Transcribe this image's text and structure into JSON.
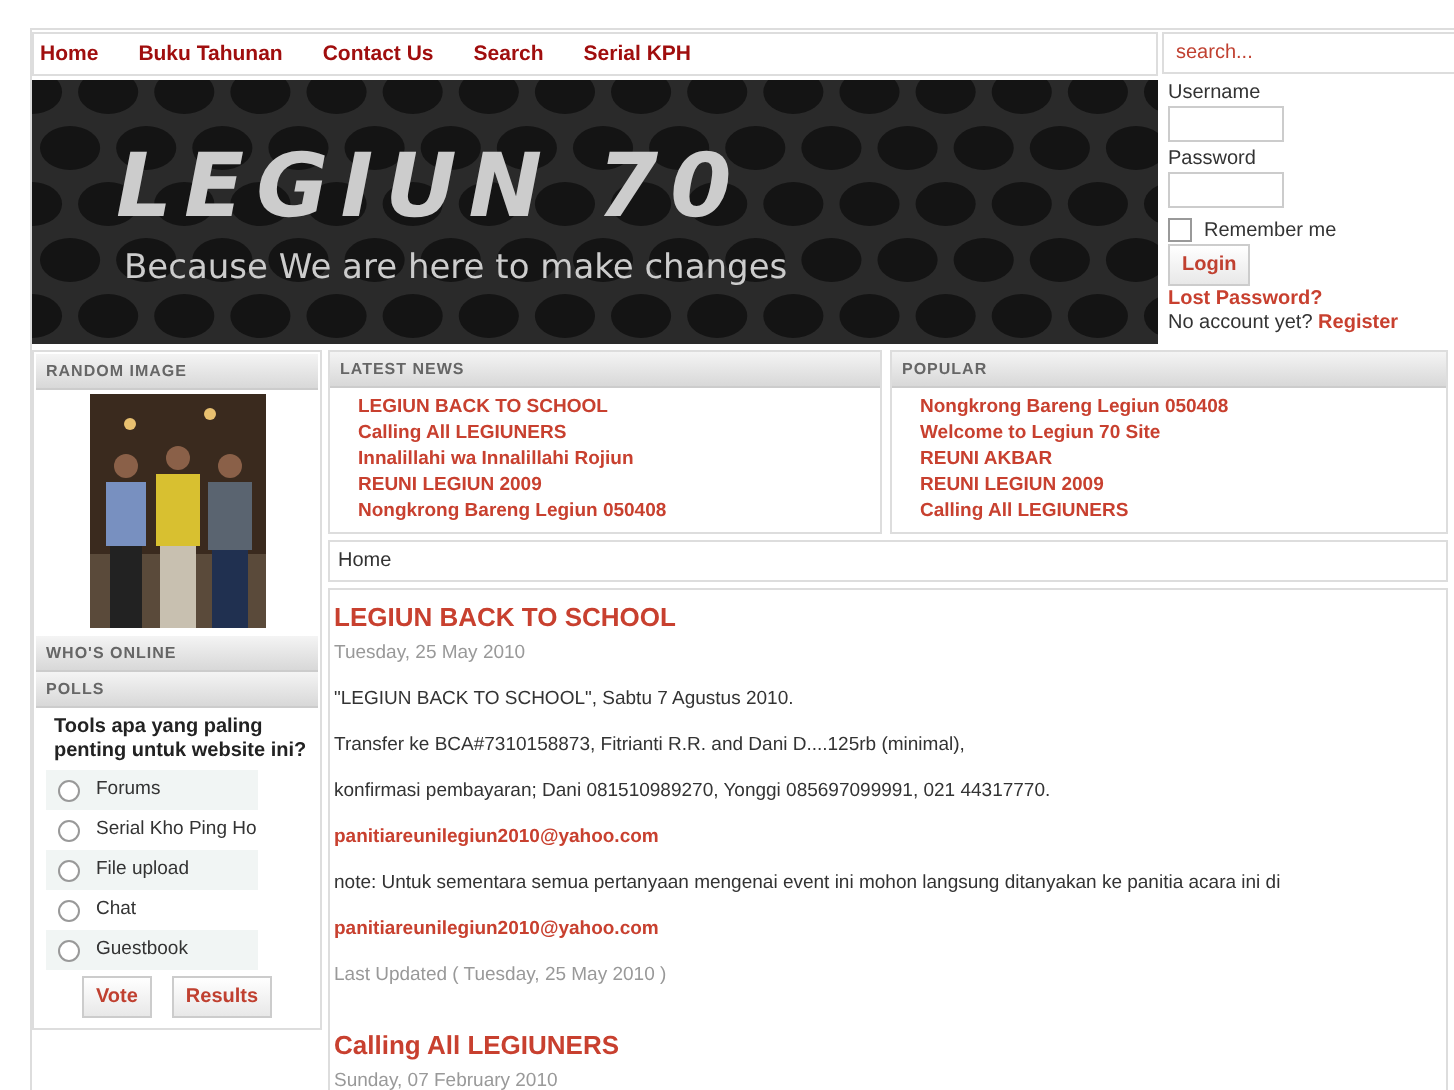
{
  "nav": {
    "items": [
      {
        "label": "Home"
      },
      {
        "label": "Buku Tahunan"
      },
      {
        "label": "Contact Us"
      },
      {
        "label": "Search"
      },
      {
        "label": "Serial KPH"
      }
    ]
  },
  "search": {
    "placeholder": "search..."
  },
  "header": {
    "logo": "LEGIUN 70",
    "tagline": "Because We are here to make changes"
  },
  "login": {
    "username_label": "Username",
    "password_label": "Password",
    "remember_label": "Remember me",
    "remember_checked": false,
    "button": "Login",
    "lost_password": "Lost Password?",
    "no_account": "No account yet?",
    "register": "Register"
  },
  "random_image": {
    "title": "RANDOM IMAGE",
    "kind": "picture"
  },
  "whos_online": {
    "title": "WHO'S ONLINE"
  },
  "polls": {
    "title": "POLLS",
    "question": "Tools apa yang paling penting untuk website ini?",
    "options": [
      {
        "label": "Forums",
        "selected": false
      },
      {
        "label": "Serial Kho Ping Ho",
        "selected": false
      },
      {
        "label": "File upload",
        "selected": false
      },
      {
        "label": "Chat",
        "selected": false
      },
      {
        "label": "Guestbook",
        "selected": false
      }
    ],
    "buttons": [
      "Vote",
      "Results"
    ]
  },
  "latest_news": {
    "title": "LATEST NEWS",
    "items": [
      "LEGIUN BACK TO SCHOOL",
      "Calling All LEGIUNERS",
      "Innalillahi wa Innalillahi Rojiun",
      "REUNI LEGIUN 2009",
      "Nongkrong Bareng Legiun 050408"
    ]
  },
  "popular": {
    "title": "POPULAR",
    "items": [
      "Nongkrong Bareng Legiun 050408",
      "Welcome to Legiun 70 Site",
      "REUNI AKBAR",
      "REUNI LEGIUN 2009",
      "Calling All LEGIUNERS"
    ]
  },
  "breadcrumb": "Home",
  "articles": [
    {
      "title": "LEGIUN BACK TO SCHOOL",
      "date": "Tuesday, 25 May 2010",
      "body": [
        {
          "kind": "text",
          "text": "\"LEGIUN BACK TO SCHOOL\", Sabtu 7 Agustus 2010."
        },
        {
          "kind": "text",
          "text": "Transfer ke BCA#7310158873, Fitrianti R.R. and Dani D....125rb (minimal),"
        },
        {
          "kind": "text",
          "text": "konfirmasi pembayaran; Dani 081510989270, Yonggi 085697099991, 021 44317770."
        },
        {
          "kind": "link",
          "text": "panitiareunilegiun2010@yahoo.com"
        },
        {
          "kind": "text",
          "text": "note: Untuk sementara semua pertanyaan mengenai event ini mohon langsung ditanyakan ke panitia acara ini di"
        },
        {
          "kind": "link",
          "text": "panitiareunilegiun2010@yahoo.com"
        }
      ],
      "updated": "Last Updated ( Tuesday, 25 May 2010 )"
    },
    {
      "title": "Calling All LEGIUNERS",
      "date": "Sunday, 07 February 2010"
    }
  ]
}
